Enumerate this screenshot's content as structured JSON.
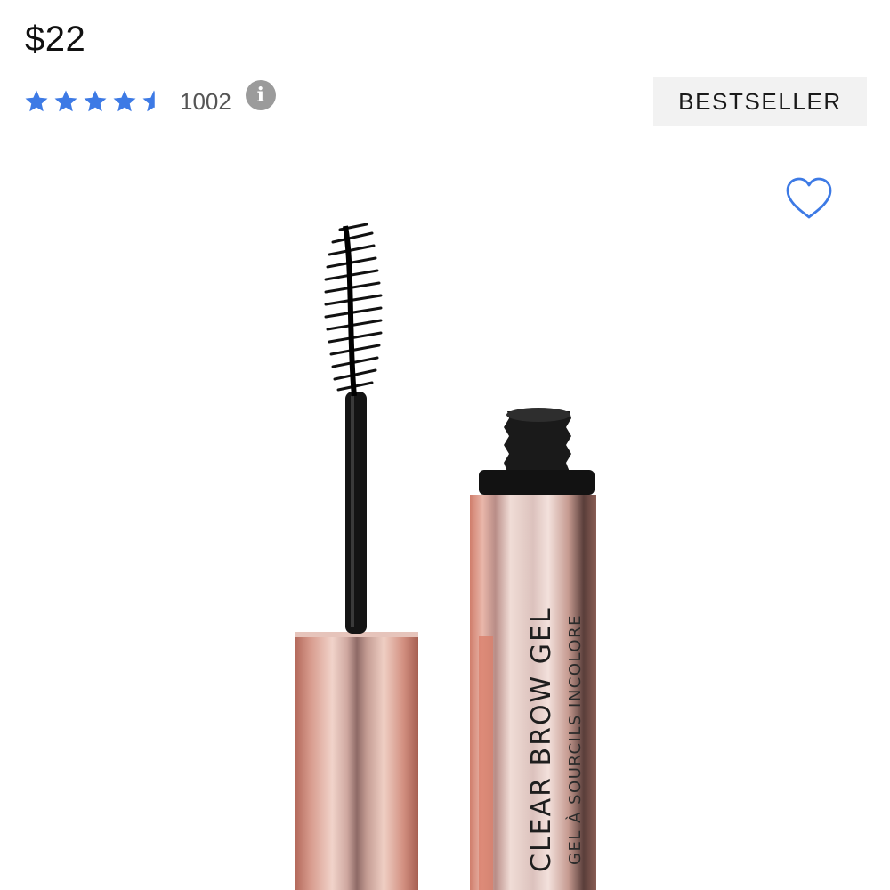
{
  "product": {
    "price": "$22",
    "rating": 4.5,
    "rating_max": 5,
    "review_count": "1002",
    "badge": "BESTSELLER",
    "image_label": {
      "main": "CLEAR BROW GEL",
      "sub": "GEL À SOURCILS INCOLORE"
    }
  },
  "icons": {
    "star": "star-icon",
    "star_half": "star-half-icon",
    "info": "info-icon",
    "heart": "heart-outline-icon"
  },
  "colors": {
    "star": "#3d7ae5",
    "heart": "#3d7ae5",
    "badge_bg": "#f2f2f2",
    "info_bg": "#9b9b9b"
  }
}
